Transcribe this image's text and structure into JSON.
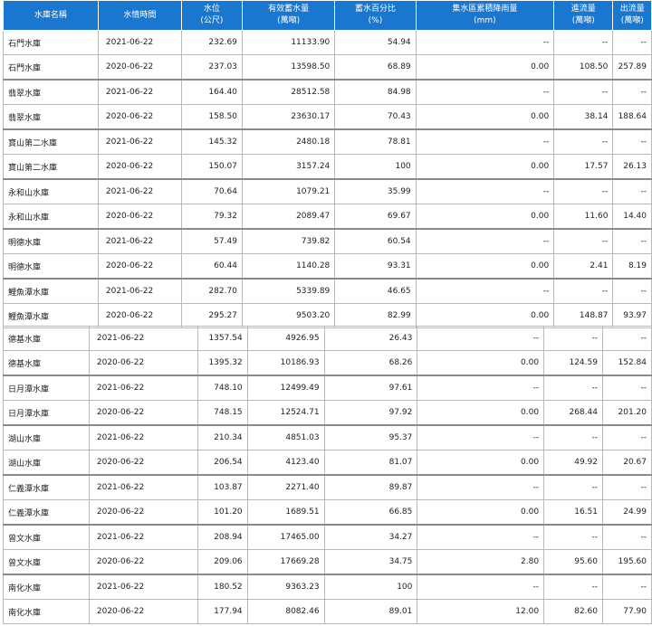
{
  "headers": [
    [
      "水庫名稱"
    ],
    [
      "水情時間"
    ],
    [
      "水位",
      "(公尺)"
    ],
    [
      "有效蓄水量",
      "(萬噸)"
    ],
    [
      "蓄水百分比",
      "(%)"
    ],
    [
      "集水區累積降雨量",
      "(mm)"
    ],
    [
      "進流量",
      "(萬噸)"
    ],
    [
      "出流量",
      "(萬噸)"
    ]
  ],
  "top_rows": [
    [
      "石門水庫",
      "2021-06-22",
      "232.69",
      "11133.90",
      "54.94",
      "--",
      "--",
      "--"
    ],
    [
      "石門水庫",
      "2020-06-22",
      "237.03",
      "13598.50",
      "68.89",
      "0.00",
      "108.50",
      "257.89"
    ],
    [
      "翡翠水庫",
      "2021-06-22",
      "164.40",
      "28512.58",
      "84.98",
      "--",
      "--",
      "--"
    ],
    [
      "翡翠水庫",
      "2020-06-22",
      "158.50",
      "23630.17",
      "70.43",
      "0.00",
      "38.14",
      "188.64"
    ],
    [
      "寶山第二水庫",
      "2021-06-22",
      "145.32",
      "2480.18",
      "78.81",
      "--",
      "--",
      "--"
    ],
    [
      "寶山第二水庫",
      "2020-06-22",
      "150.07",
      "3157.24",
      "100",
      "0.00",
      "17.57",
      "26.13"
    ],
    [
      "永和山水庫",
      "2021-06-22",
      "70.64",
      "1079.21",
      "35.99",
      "--",
      "--",
      "--"
    ],
    [
      "永和山水庫",
      "2020-06-22",
      "79.32",
      "2089.47",
      "69.67",
      "0.00",
      "11.60",
      "14.40"
    ],
    [
      "明德水庫",
      "2021-06-22",
      "57.49",
      "739.82",
      "60.54",
      "--",
      "--",
      "--"
    ],
    [
      "明德水庫",
      "2020-06-22",
      "60.44",
      "1140.28",
      "93.31",
      "0.00",
      "2.41",
      "8.19"
    ],
    [
      "鯉魚潭水庫",
      "2021-06-22",
      "282.70",
      "5339.89",
      "46.65",
      "--",
      "--",
      "--"
    ],
    [
      "鯉魚潭水庫",
      "2020-06-22",
      "295.27",
      "9503.20",
      "82.99",
      "0.00",
      "148.87",
      "93.97"
    ]
  ],
  "bottom_rows": [
    [
      "德基水庫",
      "2021-06-22",
      "1357.54",
      "4926.95",
      "26.43",
      "--",
      "--",
      "--"
    ],
    [
      "德基水庫",
      "2020-06-22",
      "1395.32",
      "10186.93",
      "68.26",
      "0.00",
      "124.59",
      "152.84"
    ],
    [
      "日月潭水庫",
      "2021-06-22",
      "748.10",
      "12499.49",
      "97.61",
      "--",
      "--",
      "--"
    ],
    [
      "日月潭水庫",
      "2020-06-22",
      "748.15",
      "12524.71",
      "97.92",
      "0.00",
      "268.44",
      "201.20"
    ],
    [
      "湖山水庫",
      "2021-06-22",
      "210.34",
      "4851.03",
      "95.37",
      "--",
      "--",
      "--"
    ],
    [
      "湖山水庫",
      "2020-06-22",
      "206.54",
      "4123.40",
      "81.07",
      "0.00",
      "49.92",
      "20.67"
    ],
    [
      "仁義潭水庫",
      "2021-06-22",
      "103.87",
      "2271.40",
      "89.87",
      "--",
      "--",
      "--"
    ],
    [
      "仁義潭水庫",
      "2020-06-22",
      "101.20",
      "1689.51",
      "66.85",
      "0.00",
      "16.51",
      "24.99"
    ],
    [
      "曾文水庫",
      "2021-06-22",
      "208.94",
      "17465.00",
      "34.27",
      "--",
      "--",
      "--"
    ],
    [
      "曾文水庫",
      "2020-06-22",
      "209.06",
      "17669.28",
      "34.75",
      "2.80",
      "95.60",
      "195.60"
    ],
    [
      "南化水庫",
      "2021-06-22",
      "180.52",
      "9363.23",
      "100",
      "--",
      "--",
      "--"
    ],
    [
      "南化水庫",
      "2020-06-22",
      "177.94",
      "8082.46",
      "89.01",
      "12.00",
      "82.60",
      "77.90"
    ]
  ]
}
